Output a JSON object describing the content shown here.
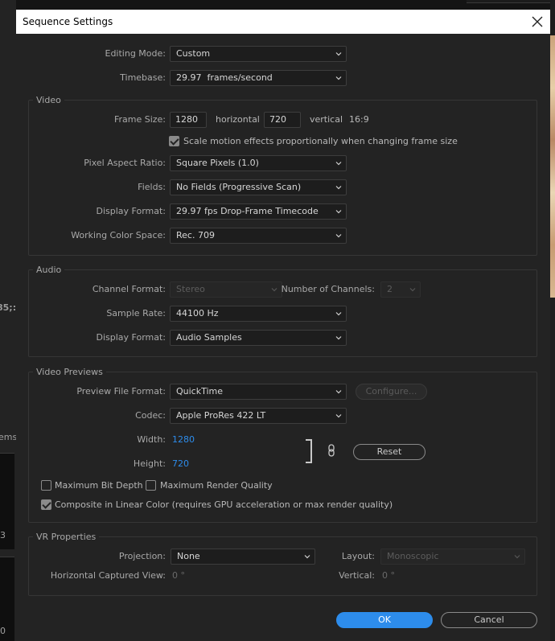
{
  "dialog": {
    "title": "Sequence Settings"
  },
  "background": {
    "left_frag_1": "85;:",
    "left_frag_2": "ems",
    "left_frag_3": "3",
    "left_frag_4": "0"
  },
  "top": {
    "editing_mode_label": "Editing Mode:",
    "editing_mode_value": "Custom",
    "timebase_label": "Timebase:",
    "timebase_value": "29.97  frames/second"
  },
  "video": {
    "group_title": "Video",
    "frame_size_label": "Frame Size:",
    "frame_width": "1280",
    "horizontal_label": "horizontal",
    "frame_height": "720",
    "vertical_label": "vertical",
    "aspect_ratio": "16:9",
    "scale_motion_label": "Scale motion effects proportionally when changing frame size",
    "scale_motion_checked": true,
    "pixel_aspect_label": "Pixel Aspect Ratio:",
    "pixel_aspect_value": "Square Pixels (1.0)",
    "fields_label": "Fields:",
    "fields_value": "No Fields (Progressive Scan)",
    "display_format_label": "Display Format:",
    "display_format_value": "29.97 fps Drop-Frame Timecode",
    "color_space_label": "Working Color Space:",
    "color_space_value": "Rec. 709"
  },
  "audio": {
    "group_title": "Audio",
    "channel_format_label": "Channel Format:",
    "channel_format_value": "Stereo",
    "num_channels_label": "Number of Channels:",
    "num_channels_value": "2",
    "sample_rate_label": "Sample Rate:",
    "sample_rate_value": "44100 Hz",
    "display_format_label": "Display Format:",
    "display_format_value": "Audio Samples"
  },
  "previews": {
    "group_title": "Video Previews",
    "file_format_label": "Preview File Format:",
    "file_format_value": "QuickTime",
    "configure_label": "Configure...",
    "codec_label": "Codec:",
    "codec_value": "Apple ProRes 422 LT",
    "width_label": "Width:",
    "width_value": "1280",
    "height_label": "Height:",
    "height_value": "720",
    "reset_label": "Reset",
    "max_bit_depth_label": "Maximum Bit Depth",
    "max_render_quality_label": "Maximum Render Quality",
    "composite_linear_label": "Composite in Linear Color (requires GPU acceleration or max render quality)",
    "composite_linear_checked": true
  },
  "vr": {
    "group_title": "VR Properties",
    "projection_label": "Projection:",
    "projection_value": "None",
    "layout_label": "Layout:",
    "layout_value": "Monoscopic",
    "h_captured_label": "Horizontal Captured View:",
    "h_captured_value": "0 °",
    "vertical_label": "Vertical:",
    "vertical_value": "0 °"
  },
  "buttons": {
    "ok": "OK",
    "cancel": "Cancel"
  },
  "colors": {
    "accent": "#2d8ceb",
    "dialog_bg": "#232323",
    "field_bg": "#1d1d1d"
  }
}
